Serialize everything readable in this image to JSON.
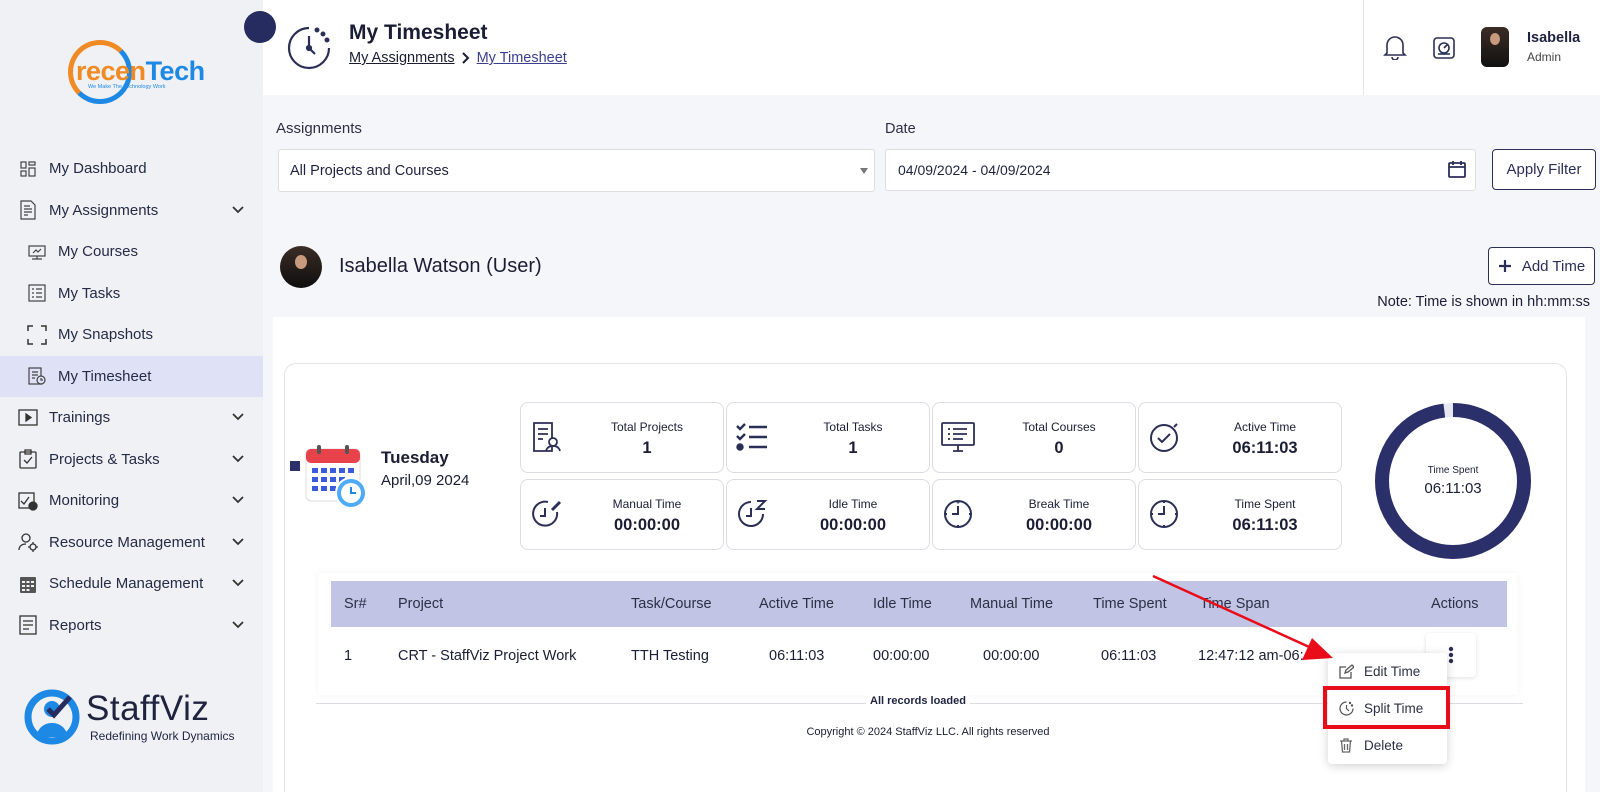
{
  "brand": {
    "company_a": "recen",
    "company_b": "Tech",
    "company_tagline": "We Make The Technology Work",
    "product": "StaffViz",
    "product_tagline": "Redefining Work Dynamics"
  },
  "sidebar": {
    "items": [
      {
        "label": "My Dashboard",
        "icon": "dashboard-icon"
      },
      {
        "label": "My Assignments",
        "icon": "assignments-icon"
      },
      {
        "label": "My Courses",
        "icon": "courses-icon"
      },
      {
        "label": "My Tasks",
        "icon": "tasks-icon"
      },
      {
        "label": "My Snapshots",
        "icon": "snapshots-icon"
      },
      {
        "label": "My Timesheet",
        "icon": "timesheet-icon"
      },
      {
        "label": "Trainings",
        "icon": "trainings-icon"
      },
      {
        "label": "Projects & Tasks",
        "icon": "projects-icon"
      },
      {
        "label": "Monitoring",
        "icon": "monitoring-icon"
      },
      {
        "label": "Resource Management",
        "icon": "resource-icon"
      },
      {
        "label": "Schedule Management",
        "icon": "schedule-icon"
      },
      {
        "label": "Reports",
        "icon": "reports-icon"
      }
    ]
  },
  "header": {
    "title": "My Timesheet",
    "breadcrumb_parent": "My Assignments",
    "breadcrumb_sep": ">",
    "breadcrumb_current": "My Timesheet",
    "user_name": "Isabella",
    "user_role": "Admin"
  },
  "filters": {
    "assignments_label": "Assignments",
    "assignments_value": "All Projects and Courses",
    "date_label": "Date",
    "date_value": "04/09/2024 - 04/09/2024",
    "apply_label": "Apply Filter"
  },
  "user": {
    "display_name": "Isabella Watson (User)",
    "add_time_label": "Add Time",
    "note": "Note: Time is shown in hh:mm:ss"
  },
  "day": {
    "weekday": "Tuesday",
    "date": "April,09 2024"
  },
  "stats": [
    {
      "label": "Total Projects",
      "value": "1",
      "icon": "projects-doc-icon"
    },
    {
      "label": "Total Tasks",
      "value": "1",
      "icon": "checklist-icon"
    },
    {
      "label": "Total Courses",
      "value": "0",
      "icon": "monitor-list-icon"
    },
    {
      "label": "Active Time",
      "value": "06:11:03",
      "icon": "stopwatch-icon"
    },
    {
      "label": "Manual Time",
      "value": "00:00:00",
      "icon": "manual-clock-icon"
    },
    {
      "label": "Idle Time",
      "value": "00:00:00",
      "icon": "idle-clock-icon"
    },
    {
      "label": "Break Time",
      "value": "00:00:00",
      "icon": "clock-icon"
    },
    {
      "label": "Time Spent",
      "value": "06:11:03",
      "icon": "clock-icon"
    }
  ],
  "donut": {
    "label": "Time Spent",
    "value": "06:11:03",
    "fraction": 0.98,
    "color": "#2b2f6a"
  },
  "table": {
    "headers": [
      "Sr#",
      "Project",
      "Task/Course",
      "Active Time",
      "Idle Time",
      "Manual Time",
      "Time Spent",
      "Time Span",
      "Actions"
    ],
    "rows": [
      [
        "1",
        "CRT - StaffViz Project Work",
        "TTH Testing",
        "06:11:03",
        "00:00:00",
        "00:00:00",
        "06:11:03",
        "12:47:12 am-06:"
      ]
    ],
    "footer": "All records loaded"
  },
  "menu": {
    "items": [
      {
        "label": "Edit Time",
        "icon": "edit-icon"
      },
      {
        "label": "Split Time",
        "icon": "split-clock-icon"
      },
      {
        "label": "Delete",
        "icon": "trash-icon"
      }
    ]
  },
  "copyright": "Copyright © 2024 StaffViz LLC. All rights reserved",
  "colors": {
    "accent": "#2b2f6a",
    "table_header": "#c2c4e6",
    "active_nav": "#dfe1f7",
    "highlight": "#e80d19"
  }
}
